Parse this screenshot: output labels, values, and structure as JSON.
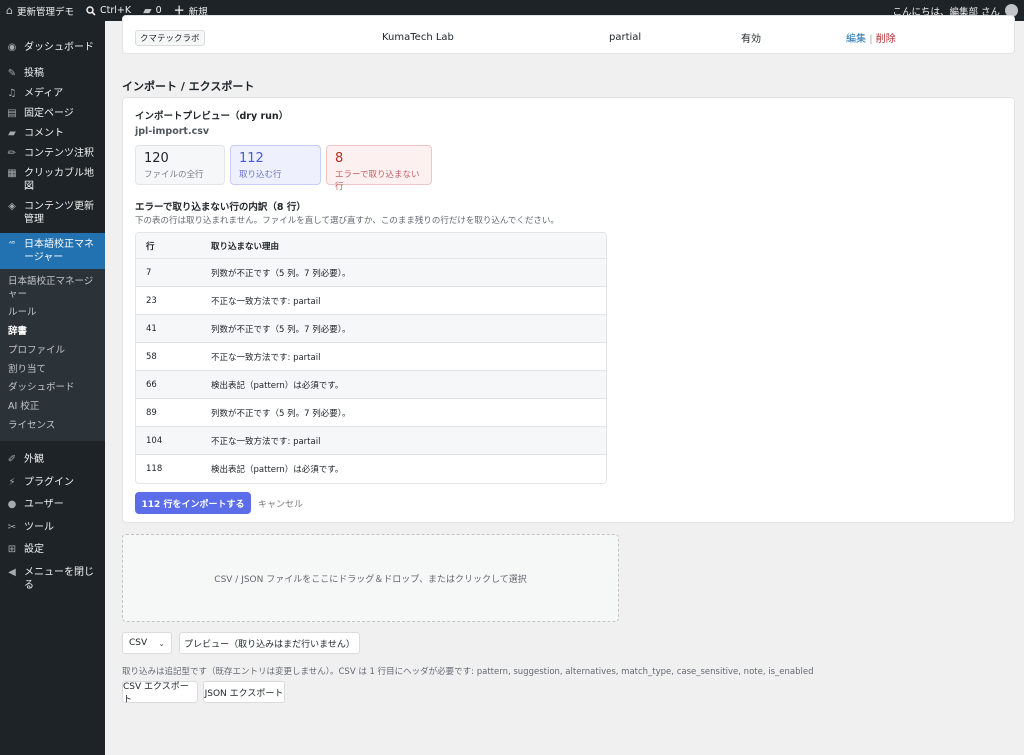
{
  "adminbar": {
    "site_name": "更新管理デモ",
    "search_shortcut": "Ctrl+K",
    "comments_count": "0",
    "new_label": "新規",
    "greeting": "こんにちは、編集部 さん"
  },
  "sidebar": {
    "items_top": [
      {
        "label": "ダッシュボード",
        "icon": "dashboard-icon",
        "glyph": "◉"
      },
      {
        "label": "投稿",
        "icon": "pin-icon",
        "glyph": "✎"
      },
      {
        "label": "メディア",
        "icon": "media-icon",
        "glyph": "♫"
      },
      {
        "label": "固定ページ",
        "icon": "page-icon",
        "glyph": "▤"
      },
      {
        "label": "コメント",
        "icon": "comment-icon",
        "glyph": "▰"
      },
      {
        "label": "コンテンツ注釈",
        "icon": "pencil-icon",
        "glyph": "✏"
      },
      {
        "label": "クリッカブル地図",
        "icon": "map-icon",
        "glyph": "▦"
      },
      {
        "label": "コンテンツ更新管理",
        "icon": "update-icon",
        "glyph": "◈"
      }
    ],
    "active_item": {
      "label": "日本語校正マネージャー",
      "icon": "proofread-icon",
      "glyph": "ᴬᴮ"
    },
    "submenu": [
      {
        "label": "日本語校正マネージャー"
      },
      {
        "label": "ルール"
      },
      {
        "label": "辞書"
      },
      {
        "label": "プロファイル"
      },
      {
        "label": "割り当て"
      },
      {
        "label": "ダッシュボード"
      },
      {
        "label": "AI 校正"
      },
      {
        "label": "ライセンス"
      }
    ],
    "current_submenu": "辞書",
    "items_bottom": [
      {
        "label": "外観",
        "icon": "appearance-icon",
        "glyph": "✐"
      },
      {
        "label": "プラグイン",
        "icon": "plugin-icon",
        "glyph": "⚡"
      },
      {
        "label": "ユーザー",
        "icon": "user-icon",
        "glyph": "●"
      },
      {
        "label": "ツール",
        "icon": "wrench-icon",
        "glyph": "✂"
      },
      {
        "label": "設定",
        "icon": "settings-icon",
        "glyph": "⊞"
      },
      {
        "label": "メニューを閉じる",
        "icon": "collapse-icon",
        "glyph": "◀"
      }
    ]
  },
  "top_row": {
    "name": "クマテックラボ",
    "suggestion": "KumaTech Lab",
    "match_type": "partial",
    "status": "有効",
    "edit": "編集",
    "separator": "|",
    "delete": "削除"
  },
  "section": {
    "title": "インポート / エクスポート"
  },
  "preview": {
    "title": "インポートプレビュー（dry run）",
    "filename": "jpl-import.csv",
    "stats": {
      "total": {
        "value": "120",
        "label": "ファイルの全行"
      },
      "import": {
        "value": "112",
        "label": "取り込む行"
      },
      "error": {
        "value": "8",
        "label": "エラーで取り込まない行"
      }
    },
    "errors_title": "エラーで取り込まない行の内訳（8 行）",
    "errors_note": "下の表の行は取り込まれません。ファイルを直して選び直すか、このまま残りの行だけを取り込んでください。",
    "table": {
      "col_row": "行",
      "col_reason": "取り込まない理由",
      "rows": [
        {
          "row": "7",
          "reason": "列数が不正です（5 列。7 列必要）。"
        },
        {
          "row": "23",
          "reason": "不正な一致方法です: partail"
        },
        {
          "row": "41",
          "reason": "列数が不正です（5 列。7 列必要）。"
        },
        {
          "row": "58",
          "reason": "不正な一致方法です: partail"
        },
        {
          "row": "66",
          "reason": "検出表記（pattern）は必須です。"
        },
        {
          "row": "89",
          "reason": "列数が不正です（5 列。7 列必要）。"
        },
        {
          "row": "104",
          "reason": "不正な一致方法です: partail"
        },
        {
          "row": "118",
          "reason": "検出表記（pattern）は必須です。"
        }
      ]
    },
    "import_button": "112 行をインポートする",
    "cancel": "キャンセル"
  },
  "dropzone": {
    "text": "CSV / JSON ファイルをここにドラッグ＆ドロップ、またはクリックして選択"
  },
  "format_select": {
    "value": "CSV"
  },
  "preview_button": "プレビュー（取り込みはまだ行いません）",
  "help_text": "取り込みは追記型です（既存エントリは変更しません）。CSV は 1 行目にヘッダが必要です: pattern, suggestion, alternatives, match_type, case_sensitive, note, is_enabled",
  "export": {
    "csv": "CSV エクスポート",
    "json": "JSON エクスポート"
  },
  "colors": {
    "primary": "#5b6de8",
    "wp_blue": "#2271b1",
    "error_red": "#b32d2e",
    "import_blue": "#4c5bd4"
  }
}
